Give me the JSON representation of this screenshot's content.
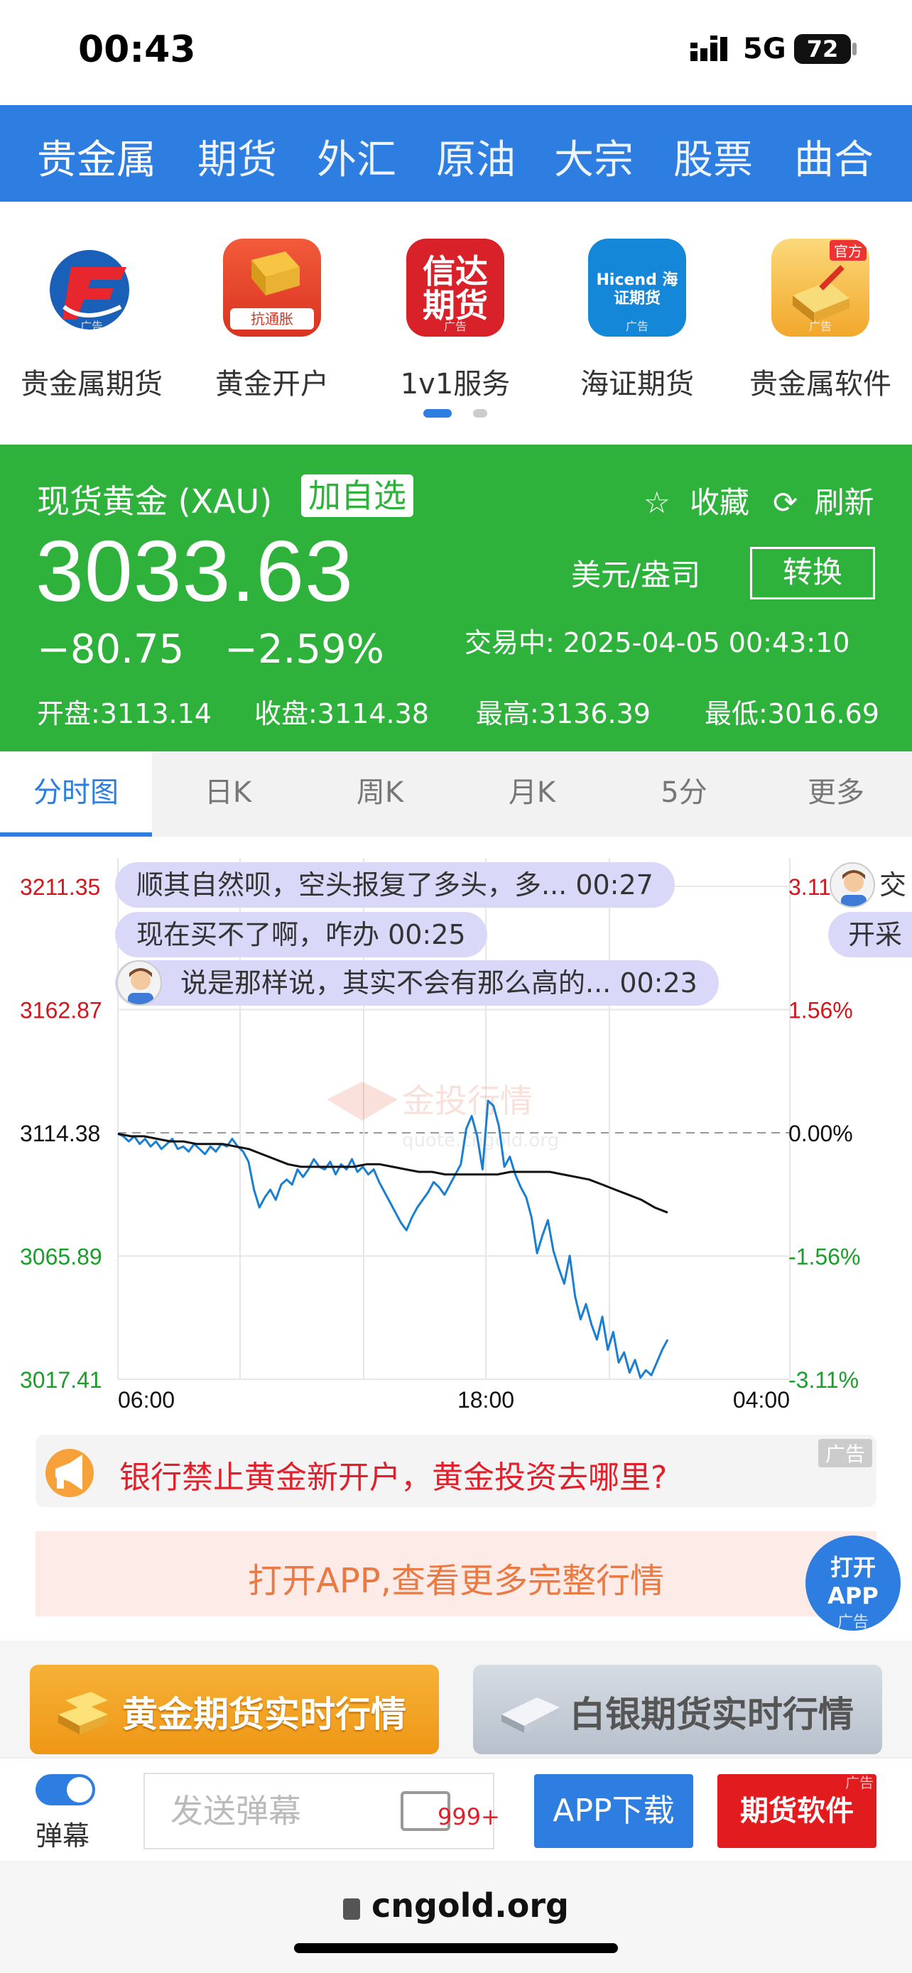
{
  "status_bar": {
    "time": "00:43",
    "network": "5G",
    "battery": "72"
  },
  "top_nav": [
    "贵金属",
    "期货",
    "外汇",
    "原油",
    "大宗",
    "股票",
    "曲合"
  ],
  "apps": [
    {
      "label": "贵金属期货",
      "ad": "广告"
    },
    {
      "label": "黄金开户",
      "ad": "广告",
      "logo_text": "抗通胀"
    },
    {
      "label": "1v1服务",
      "ad": "广告",
      "logo_text": "信达期货"
    },
    {
      "label": "海证期货",
      "ad": "广告",
      "logo_text": "Hicend 海证期货"
    },
    {
      "label": "贵金属软件",
      "ad": "广告",
      "logo_text": "官方"
    }
  ],
  "quote": {
    "name": "现货黄金 (XAU)",
    "add_watch": "加自选",
    "favorite": "收藏",
    "refresh": "刷新",
    "price": "3033.63",
    "change": "−80.75",
    "change_pct": "−2.59%",
    "unit": "美元/盎司",
    "convert": "转换",
    "trading_status": "交易中:  2025-04-05 00:43:10",
    "open": "开盘:3113.14",
    "close": "收盘:3114.38",
    "high": "最高:3136.39",
    "low": "最低:3016.69",
    "color_down": "#2eb23c"
  },
  "tabs": [
    "分时图",
    "日K",
    "周K",
    "月K",
    "5分",
    "更多"
  ],
  "chart_data": {
    "type": "line",
    "y_ticks_left": [
      "3211.35",
      "3162.87",
      "3114.38",
      "3065.89",
      "3017.41"
    ],
    "y_ticks_right": [
      "3.11%",
      "1.56%",
      "0.00%",
      "-1.56%",
      "-3.11%"
    ],
    "x_ticks": [
      "06:00",
      "18:00",
      "04:00"
    ],
    "ylim": [
      3017.41,
      3211.35
    ],
    "prev_close": 3114.38,
    "watermark": "金投行情",
    "watermark_sub": "quote.cngold.org",
    "series": [
      {
        "values": [
          3114,
          3113,
          3111,
          3113,
          3110,
          3112,
          3109,
          3111,
          3108,
          3110,
          3112,
          3108,
          3109,
          3107,
          3110,
          3108,
          3106,
          3109,
          3107,
          3110,
          3109,
          3112,
          3109,
          3107,
          3103,
          3092,
          3085,
          3089,
          3092,
          3088,
          3094,
          3096,
          3094,
          3100,
          3097,
          3100,
          3104,
          3101,
          3100,
          3103,
          3098,
          3102,
          3100,
          3104,
          3099,
          3101,
          3098,
          3100,
          3095,
          3091,
          3087,
          3083,
          3079,
          3076,
          3081,
          3085,
          3088,
          3091,
          3095,
          3093,
          3090,
          3094,
          3098,
          3102,
          3116,
          3121,
          3113,
          3100,
          3127,
          3125,
          3117,
          3101,
          3105,
          3098,
          3093,
          3089,
          3081,
          3067,
          3074,
          3080,
          3068,
          3061,
          3055,
          3066,
          3050,
          3041,
          3047,
          3039,
          3033,
          3042,
          3029,
          3036,
          3024,
          3028,
          3020,
          3025,
          3018,
          3021,
          3019,
          3024,
          3029,
          3033
        ]
      },
      {
        "values": [
          3114,
          3113,
          3113,
          3112,
          3111,
          3111,
          3110,
          3110,
          3110,
          3109,
          3108,
          3106,
          3104,
          3102,
          3101,
          3101,
          3101,
          3101,
          3101,
          3102,
          3102,
          3101,
          3100,
          3099,
          3099,
          3098,
          3098,
          3098,
          3098,
          3098,
          3099,
          3099,
          3099,
          3099,
          3098,
          3097,
          3096,
          3094,
          3092,
          3090,
          3088,
          3085,
          3083
        ]
      }
    ]
  },
  "danmaku": [
    {
      "text": "顺其自然呗，空头报复了多头，多... 00:27"
    },
    {
      "text": "现在买不了啊，咋办 00:25"
    },
    {
      "text": "说是那样说，其实不会有那么高的... 00:23"
    },
    {
      "text": "交"
    },
    {
      "text": "开采"
    }
  ],
  "banner": {
    "text": "银行禁止黄金新开户，黄金投资去哪里?",
    "ad": "广告"
  },
  "open_app_bar": {
    "text": "打开APP,查看更多完整行情"
  },
  "open_app_button": {
    "line1": "打开",
    "line2": "APP",
    "ad": "广告"
  },
  "gold_button": "黄金期货实时行情",
  "silver_button": "白银期货实时行情",
  "bottom_bar": {
    "danmaku_toggle": "弹幕",
    "send_placeholder": "发送弹幕",
    "msg_count": "999+",
    "app_download": "APP下载",
    "futures_software": "期货软件",
    "ad": "广告"
  },
  "url": "cngold.org",
  "partial_right_tick": "3.1"
}
